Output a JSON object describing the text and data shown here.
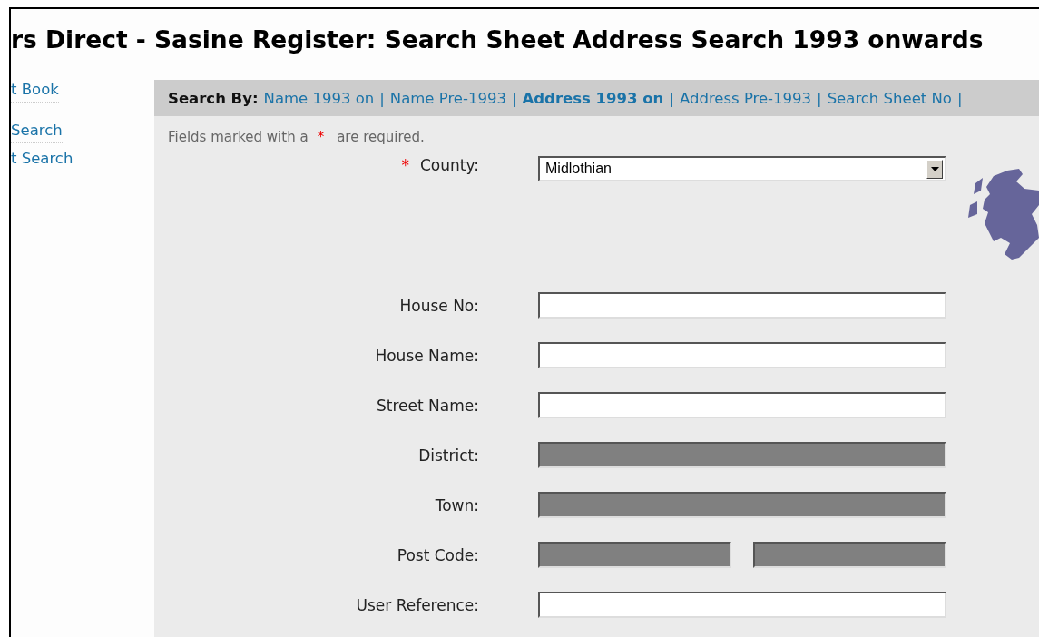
{
  "page_title": "rs Direct - Sasine Register: Search Sheet Address Search 1993 onwards",
  "sidebar": {
    "items": [
      {
        "label": "t Book"
      },
      {
        "label": "Search"
      },
      {
        "label": "t Search"
      }
    ]
  },
  "search_by": {
    "label": "Search By:",
    "links": [
      {
        "label": "Name 1993 on",
        "selected": false,
        "separator": "|"
      },
      {
        "label": "Name Pre-1993",
        "selected": false,
        "separator": "|"
      },
      {
        "label": "Address 1993 on",
        "selected": true,
        "separator": "|"
      },
      {
        "label": "Address Pre-1993",
        "selected": false,
        "separator": "|"
      },
      {
        "label": "Search Sheet No",
        "selected": false,
        "separator": "|"
      }
    ]
  },
  "required_note": {
    "before": "Fields marked with a",
    "mark": "*",
    "after": "are required."
  },
  "fields": [
    {
      "kind": "select",
      "label": "County:",
      "required_mark": "*",
      "value": "Midlothian"
    },
    {
      "kind": "text",
      "label": "House No:",
      "inputs": [
        {
          "disabled": false
        }
      ]
    },
    {
      "kind": "text",
      "label": "House Name:",
      "inputs": [
        {
          "disabled": false
        }
      ]
    },
    {
      "kind": "text",
      "label": "Street Name:",
      "inputs": [
        {
          "disabled": false
        }
      ]
    },
    {
      "kind": "text",
      "label": "District:",
      "inputs": [
        {
          "disabled": true
        }
      ]
    },
    {
      "kind": "text",
      "label": "Town:",
      "inputs": [
        {
          "disabled": true
        }
      ]
    },
    {
      "kind": "text",
      "label": "Post Code:",
      "inputs": [
        {
          "disabled": true
        },
        {
          "disabled": true
        }
      ]
    },
    {
      "kind": "text",
      "label": "User Reference:",
      "inputs": [
        {
          "disabled": false
        }
      ]
    }
  ]
}
